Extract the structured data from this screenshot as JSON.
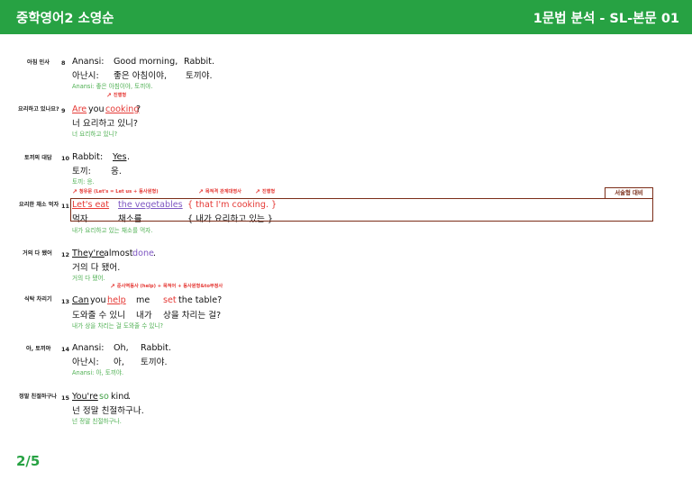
{
  "header": {
    "title_left": "중학영어2 소영순",
    "title_right": "1문법 분석 - SL-본문 01"
  },
  "footer": {
    "page": "2/5"
  },
  "sentences": [
    {
      "label": "아침 인사",
      "num": "8",
      "tokens": [
        "Anansi:",
        "Good morning,",
        "Rabbit."
      ],
      "kor": [
        "아난시:",
        "좋은 아침이야,",
        "토끼야."
      ],
      "translation": "Anansi: 좋은 아침이야, 토끼야."
    },
    {
      "label": "요리하고 있나요?",
      "num": "9",
      "note": "진행형",
      "tokens": [
        "Are",
        "you",
        "cooking",
        "?"
      ],
      "kor_line": "너 요리하고 있니?",
      "translation": "너 요리하고 있니?"
    },
    {
      "label": "토끼의 대답",
      "num": "10",
      "tokens": [
        "Rabbit:",
        "Yes",
        "."
      ],
      "kor": [
        "토끼:",
        "응."
      ],
      "translation": "토끼: 응."
    },
    {
      "label": "요리한 채소 먹자",
      "num": "11",
      "notes": [
        "청유문 (Let's = Let us + 동사원형)",
        "목적격 관계대명사",
        "진행형"
      ],
      "tokens": [
        "Let's eat",
        "the vegetables",
        "{ that I'm cooking. }"
      ],
      "kor": [
        "먹자",
        "채소를",
        "{ 내가 요리하고 있는 }"
      ],
      "translation": "내가 요리하고 있는 채소를 먹자.",
      "tag": "서술형 대비"
    },
    {
      "label": "거의 다 됐어",
      "num": "12",
      "tokens": [
        "They're",
        "almost",
        "done",
        "."
      ],
      "kor_line": "거의 다 됐어.",
      "translation": "거의 다 됐어."
    },
    {
      "label": "식탁 차리기",
      "num": "13",
      "note": "준사역동사 (help) + 목적어 + 동사원형&to부정사",
      "tokens": [
        "Can",
        "you",
        "help",
        "me",
        "set",
        "the table?"
      ],
      "kor": [
        "도와줄 수 있니",
        "내가",
        "상을 차리는 걸?"
      ],
      "translation": "내가 상을 차리는 걸 도와줄 수 있니?"
    },
    {
      "label": "아, 토끼야",
      "num": "14",
      "tokens": [
        "Anansi:",
        "Oh,",
        "Rabbit."
      ],
      "kor": [
        "아난시:",
        "아,",
        "토끼야."
      ],
      "translation": "Anansi: 아, 토끼야."
    },
    {
      "label": "정말 친절하구나",
      "num": "15",
      "tokens": [
        "You're",
        "so",
        "kind",
        "."
      ],
      "kor_line": "넌 정말 친절하구나.",
      "translation": "넌 정말 친절하구나."
    }
  ]
}
